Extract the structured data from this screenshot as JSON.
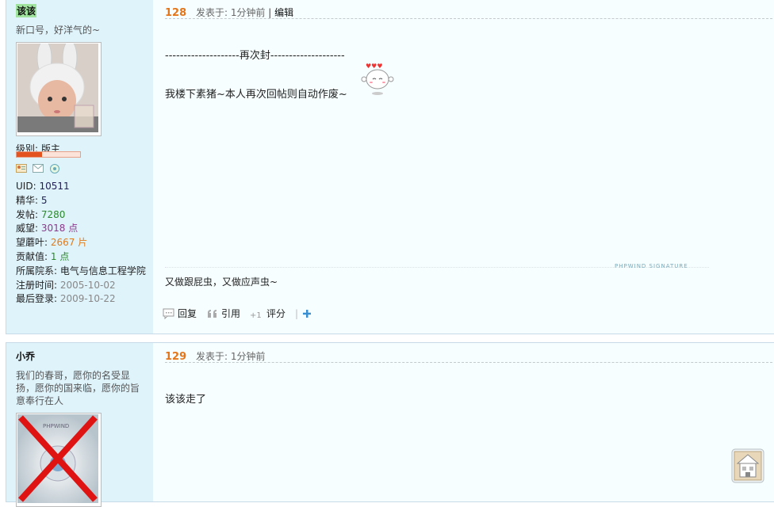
{
  "posts": [
    {
      "user": {
        "name": "该该",
        "title": "新口号，好洋气的~",
        "rank_label": "级别:",
        "rank": "版主",
        "rank_progress": 0.4,
        "stats": [
          {
            "label": "UID:",
            "value": "10511"
          },
          {
            "label": "精华:",
            "value": "5"
          },
          {
            "label": "发帖:",
            "value": "7280"
          },
          {
            "label": "威望:",
            "value": "3018 点"
          },
          {
            "label": "望蘑叶:",
            "value": "2667 片"
          },
          {
            "label": "贡献值:",
            "value": "1 点"
          },
          {
            "label": "所属院系:",
            "value": "电气与信息工程学院"
          },
          {
            "label": "注册时间:",
            "value": "2005-10-02"
          },
          {
            "label": "最后登录:",
            "value": "2009-10-22"
          }
        ]
      },
      "floor": "128",
      "time": "发表于: 1分钟前",
      "sep": "|",
      "edit": "编辑",
      "content": [
        "--------------------再次封--------------------",
        "我楼下素猪~本人再次回帖则自动作废~"
      ],
      "signature_tag": "PHPWIND SIGNATURE",
      "signature": "又做跟屁虫，又做应声虫~",
      "actions": {
        "reply": "回复",
        "quote": "引用",
        "rate": "评分"
      }
    },
    {
      "user": {
        "name": "小乔",
        "title": "我们的春哥，愿你的名受显扬，愿你的国来临，愿你的旨意奉行在人",
        "avatar_text": "PHPWIND"
      },
      "floor": "129",
      "time": "发表于: 1分钟前",
      "content": [
        "该该走了"
      ]
    }
  ]
}
